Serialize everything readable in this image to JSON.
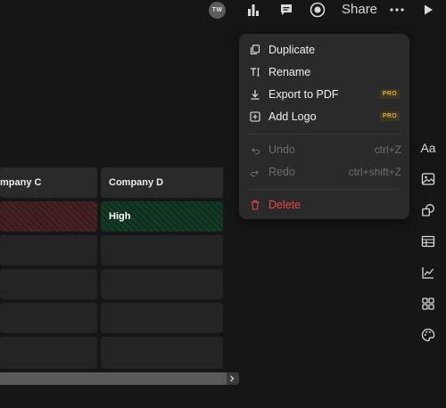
{
  "toolbar": {
    "avatar_initials": "TW",
    "share_label": "Share",
    "icons": [
      "bar-chart-icon",
      "comment-icon",
      "record-icon",
      "more-icon",
      "play-icon"
    ]
  },
  "table": {
    "columns": [
      "mpany C",
      "Company D"
    ],
    "rows": [
      [
        "",
        "High"
      ],
      [
        "",
        ""
      ],
      [
        "",
        ""
      ],
      [
        "",
        ""
      ],
      [
        "",
        ""
      ]
    ],
    "colors": {
      "high_negative": "#3a1c1e",
      "high_positive": "#10301f"
    }
  },
  "menu": {
    "items": [
      {
        "label": "Duplicate",
        "icon": "duplicate-icon"
      },
      {
        "label": "Rename",
        "icon": "rename-icon"
      },
      {
        "label": "Export to PDF",
        "icon": "download-icon",
        "badge": "PRO"
      },
      {
        "label": "Add Logo",
        "icon": "add-box-icon",
        "badge": "PRO"
      },
      {
        "label": "Undo",
        "icon": "undo-icon",
        "shortcut": "ctrl+Z",
        "disabled": true
      },
      {
        "label": "Redo",
        "icon": "redo-icon",
        "shortcut": "ctrl+shift+Z",
        "disabled": true
      },
      {
        "label": "Delete",
        "icon": "trash-icon",
        "danger": true
      }
    ]
  },
  "sidebar": {
    "text_label": "Aa",
    "icons": [
      "text-icon",
      "image-icon",
      "shapes-icon",
      "table-icon",
      "line-chart-icon",
      "grid-icon",
      "palette-icon"
    ]
  },
  "colors": {
    "accent_pro": "#d6ad3b",
    "danger": "#e54848",
    "background": "#161616"
  }
}
